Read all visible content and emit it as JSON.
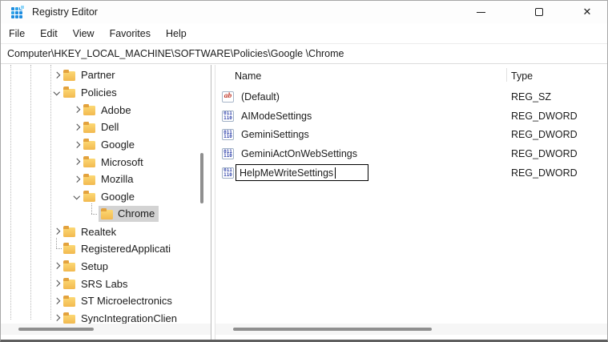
{
  "window": {
    "title": "Registry Editor",
    "controls": {
      "minimize": "minimize",
      "maximize": "maximize",
      "close": "✕"
    }
  },
  "menu": {
    "items": [
      {
        "label": "File"
      },
      {
        "label": "Edit"
      },
      {
        "label": "View"
      },
      {
        "label": "Favorites"
      },
      {
        "label": "Help"
      }
    ]
  },
  "address_bar": {
    "path": "Computer\\HKEY_LOCAL_MACHINE\\SOFTWARE\\Policies\\Google \\Chrome"
  },
  "tree": {
    "items": [
      {
        "label": "Partner",
        "level": 1,
        "state": "collapsed"
      },
      {
        "label": "Policies",
        "level": 1,
        "state": "expanded"
      },
      {
        "label": "Adobe",
        "level": 2,
        "state": "collapsed"
      },
      {
        "label": "Dell",
        "level": 2,
        "state": "collapsed"
      },
      {
        "label": "Google",
        "level": 2,
        "state": "collapsed"
      },
      {
        "label": "Microsoft",
        "level": 2,
        "state": "collapsed"
      },
      {
        "label": "Mozilla",
        "level": 2,
        "state": "collapsed"
      },
      {
        "label": "Google",
        "level": 2,
        "state": "expanded"
      },
      {
        "label": "Chrome",
        "level": 3,
        "state": "leaf",
        "selected": true
      },
      {
        "label": "Realtek",
        "level": 1,
        "state": "collapsed"
      },
      {
        "label": "RegisteredApplicati",
        "level": 1,
        "state": "leaf"
      },
      {
        "label": "Setup",
        "level": 1,
        "state": "collapsed"
      },
      {
        "label": "SRS Labs",
        "level": 1,
        "state": "collapsed"
      },
      {
        "label": "ST Microelectronics",
        "level": 1,
        "state": "collapsed"
      },
      {
        "label": "SyncIntegrationClien",
        "level": 1,
        "state": "collapsed"
      }
    ]
  },
  "list": {
    "columns": {
      "name": "Name",
      "type": "Type"
    },
    "rows": [
      {
        "name": "(Default)",
        "type": "REG_SZ",
        "icon": "string"
      },
      {
        "name": "AIModeSettings",
        "type": "REG_DWORD",
        "icon": "dword"
      },
      {
        "name": "GeminiSettings",
        "type": "REG_DWORD",
        "icon": "dword"
      },
      {
        "name": "GeminiActOnWebSettings",
        "type": "REG_DWORD",
        "icon": "dword"
      },
      {
        "name": "HelpMeWriteSettings",
        "type": "REG_DWORD",
        "icon": "dword",
        "editing": true
      }
    ]
  },
  "icons": {
    "string_glyph": "ab",
    "dword_row1": "011",
    "dword_row2": "110"
  },
  "colors": {
    "selection_inactive": "#d3d3d3",
    "folder_yellow": "#f2b94f",
    "dword_blue": "#3648ad",
    "string_red": "#c0392b",
    "app_icon_blue": "#1d8de0"
  }
}
